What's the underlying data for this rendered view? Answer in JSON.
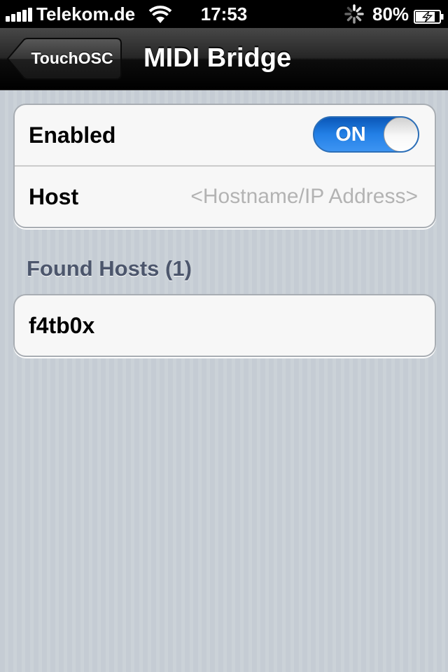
{
  "status_bar": {
    "carrier": "Telekom.de",
    "time": "17:53",
    "battery_percent": "80%",
    "signal_bars": 5,
    "battery_level": 0.8,
    "charging": true
  },
  "nav_bar": {
    "back_label": "TouchOSC",
    "title": "MIDI Bridge"
  },
  "settings": {
    "enabled_label": "Enabled",
    "enabled_state": "ON",
    "host_label": "Host",
    "host_value": "",
    "host_placeholder": "<Hostname/IP Address>"
  },
  "found_hosts": {
    "header": "Found Hosts (1)",
    "items": [
      {
        "name": "f4tb0x"
      }
    ]
  },
  "colors": {
    "toggle_on": "#2380e6",
    "section_header": "#4c566c",
    "background": "#c5ccd4"
  },
  "icons": [
    "signal-bars-icon",
    "wifi-icon",
    "activity-spinner-icon",
    "battery-charging-icon",
    "back-arrow-icon"
  ]
}
